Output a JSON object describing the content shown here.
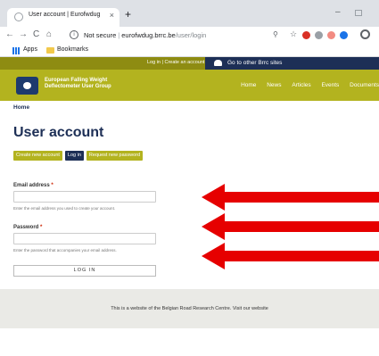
{
  "browser": {
    "tab_title": "User account | Eurofwdug",
    "tab_close": "×",
    "new_tab": "+",
    "window_minimize": "–",
    "nav": {
      "back": "←",
      "forward": "→",
      "reload": "C",
      "home": "⌂"
    },
    "address": {
      "security_label": "Not secure",
      "host": "eurofwdug.brrc.be",
      "path": "/user/login"
    },
    "bookmarks": {
      "apps": "Apps",
      "bookmarks": "Bookmarks"
    },
    "extension_colors": [
      "#d93025",
      "#9aa0a6",
      "#f28b82",
      "#1a73e8"
    ]
  },
  "site": {
    "top_bar": {
      "login_links": "Log in | Create an account",
      "other_sites": "Go to other Brrc sites"
    },
    "org_name": "European Falling Weight Deflectometer User Group",
    "nav": [
      "Home",
      "News",
      "Articles",
      "Events",
      "Documents"
    ],
    "breadcrumb": "Home",
    "page_title": "User account",
    "tabs": [
      {
        "label": "Create new account",
        "active": false
      },
      {
        "label": "Log in",
        "active": true
      },
      {
        "label": "Request new password",
        "active": false
      }
    ],
    "form": {
      "email_label": "Email address",
      "email_required": "*",
      "email_help": "Enter the email address you used to create your account.",
      "password_label": "Password",
      "password_required": "*",
      "password_help": "Enter the password that accompanies your email address.",
      "submit_label": "LOG IN"
    },
    "footer_text": "This is a website of the Belgian Road Research Centre. Visit our website"
  },
  "colors": {
    "olive": "#b3b31f",
    "dark_olive": "#8e8c12",
    "navy": "#1d2f56",
    "arrow_red": "#e60000"
  }
}
